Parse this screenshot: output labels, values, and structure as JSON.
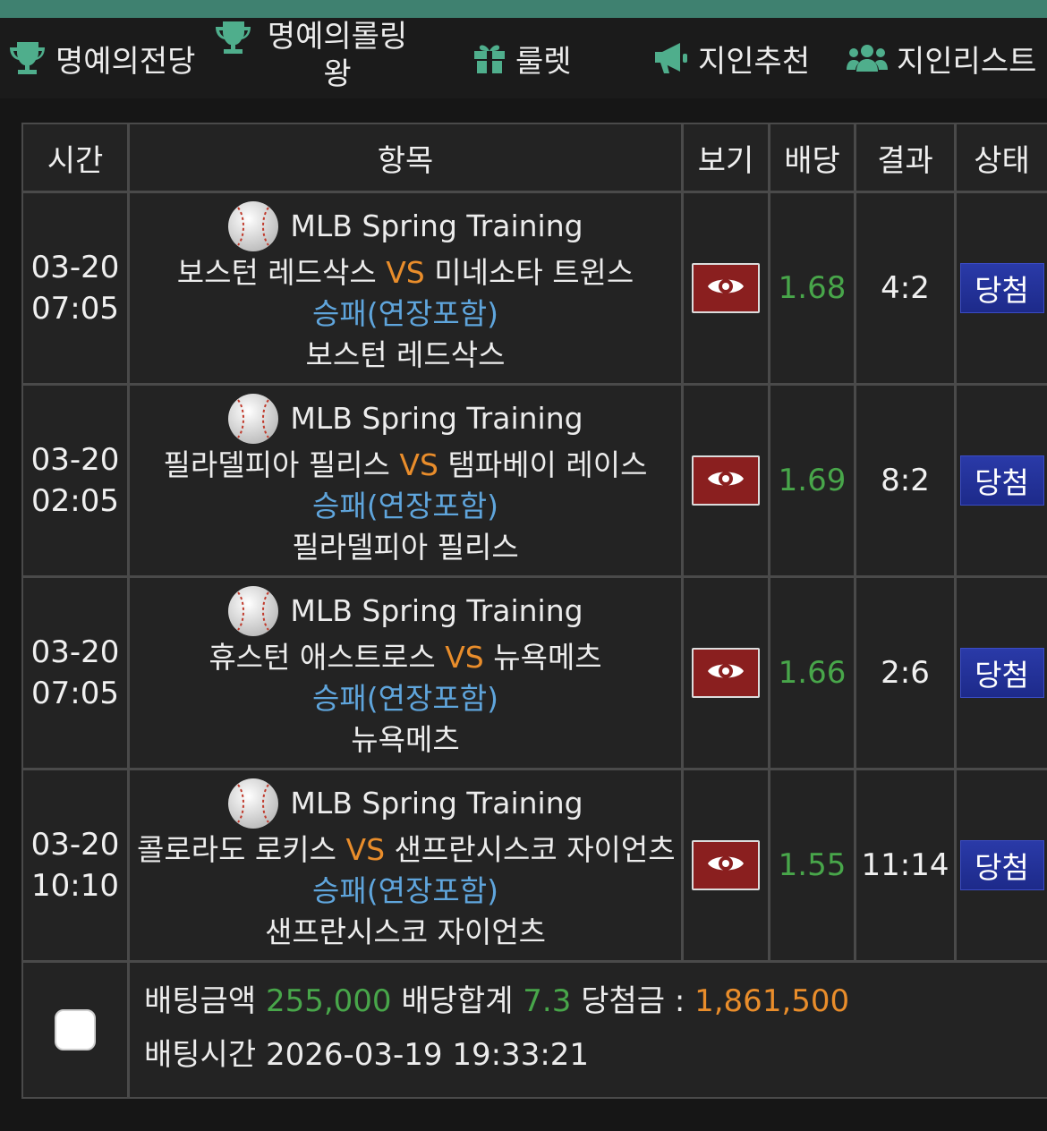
{
  "nav": {
    "items": [
      {
        "label": "명예의전당",
        "icon": "trophy-icon"
      },
      {
        "label": "명예의롤링왕",
        "icon": "trophy-icon"
      },
      {
        "label": "룰렛",
        "icon": "gift-icon"
      },
      {
        "label": "지인추천",
        "icon": "megaphone-icon"
      },
      {
        "label": "지인리스트",
        "icon": "users-icon"
      }
    ]
  },
  "colors": {
    "accent_top": "#3f8170",
    "vs": "#e98d2b",
    "market": "#5fa5dc",
    "odds": "#48a64a",
    "status_badge": "#1d2a8a",
    "view_button": "#8a1f1f"
  },
  "table": {
    "headers": [
      "시간",
      "항목",
      "보기",
      "배당",
      "결과",
      "상태"
    ],
    "rows": [
      {
        "date": "03-20",
        "time": "07:05",
        "league": "MLB Spring Training",
        "home": "보스턴 레드삭스",
        "vs": "VS",
        "away": "미네소타 트윈스",
        "market": "승패(연장포함)",
        "pick": "보스턴 레드삭스",
        "odds": "1.68",
        "result": "4:2",
        "status": "당첨"
      },
      {
        "date": "03-20",
        "time": "02:05",
        "league": "MLB Spring Training",
        "home": "필라델피아 필리스",
        "vs": "VS",
        "away": "탬파베이 레이스",
        "market": "승패(연장포함)",
        "pick": "필라델피아 필리스",
        "odds": "1.69",
        "result": "8:2",
        "status": "당첨"
      },
      {
        "date": "03-20",
        "time": "07:05",
        "league": "MLB Spring Training",
        "home": "휴스턴 애스트로스",
        "vs": "VS",
        "away": "뉴욕메츠",
        "market": "승패(연장포함)",
        "pick": "뉴욕메츠",
        "odds": "1.66",
        "result": "2:6",
        "status": "당첨"
      },
      {
        "date": "03-20",
        "time": "10:10",
        "league": "MLB Spring Training",
        "home": "콜로라도 로키스",
        "vs": "VS",
        "away": "샌프란시스코 자이언츠",
        "market": "승패(연장포함)",
        "pick": "샌프란시스코 자이언츠",
        "odds": "1.55",
        "result": "11:14",
        "status": "당첨"
      }
    ]
  },
  "summary": {
    "bet_amount_label": "배팅금액",
    "bet_amount": "255,000",
    "odds_total_label": "배당합계",
    "odds_total": "7.3",
    "win_amount_label": "당첨금 :",
    "win_amount": "1,861,500",
    "bet_time_label": "배팅시간",
    "bet_time": "2026-03-19 19:33:21"
  }
}
